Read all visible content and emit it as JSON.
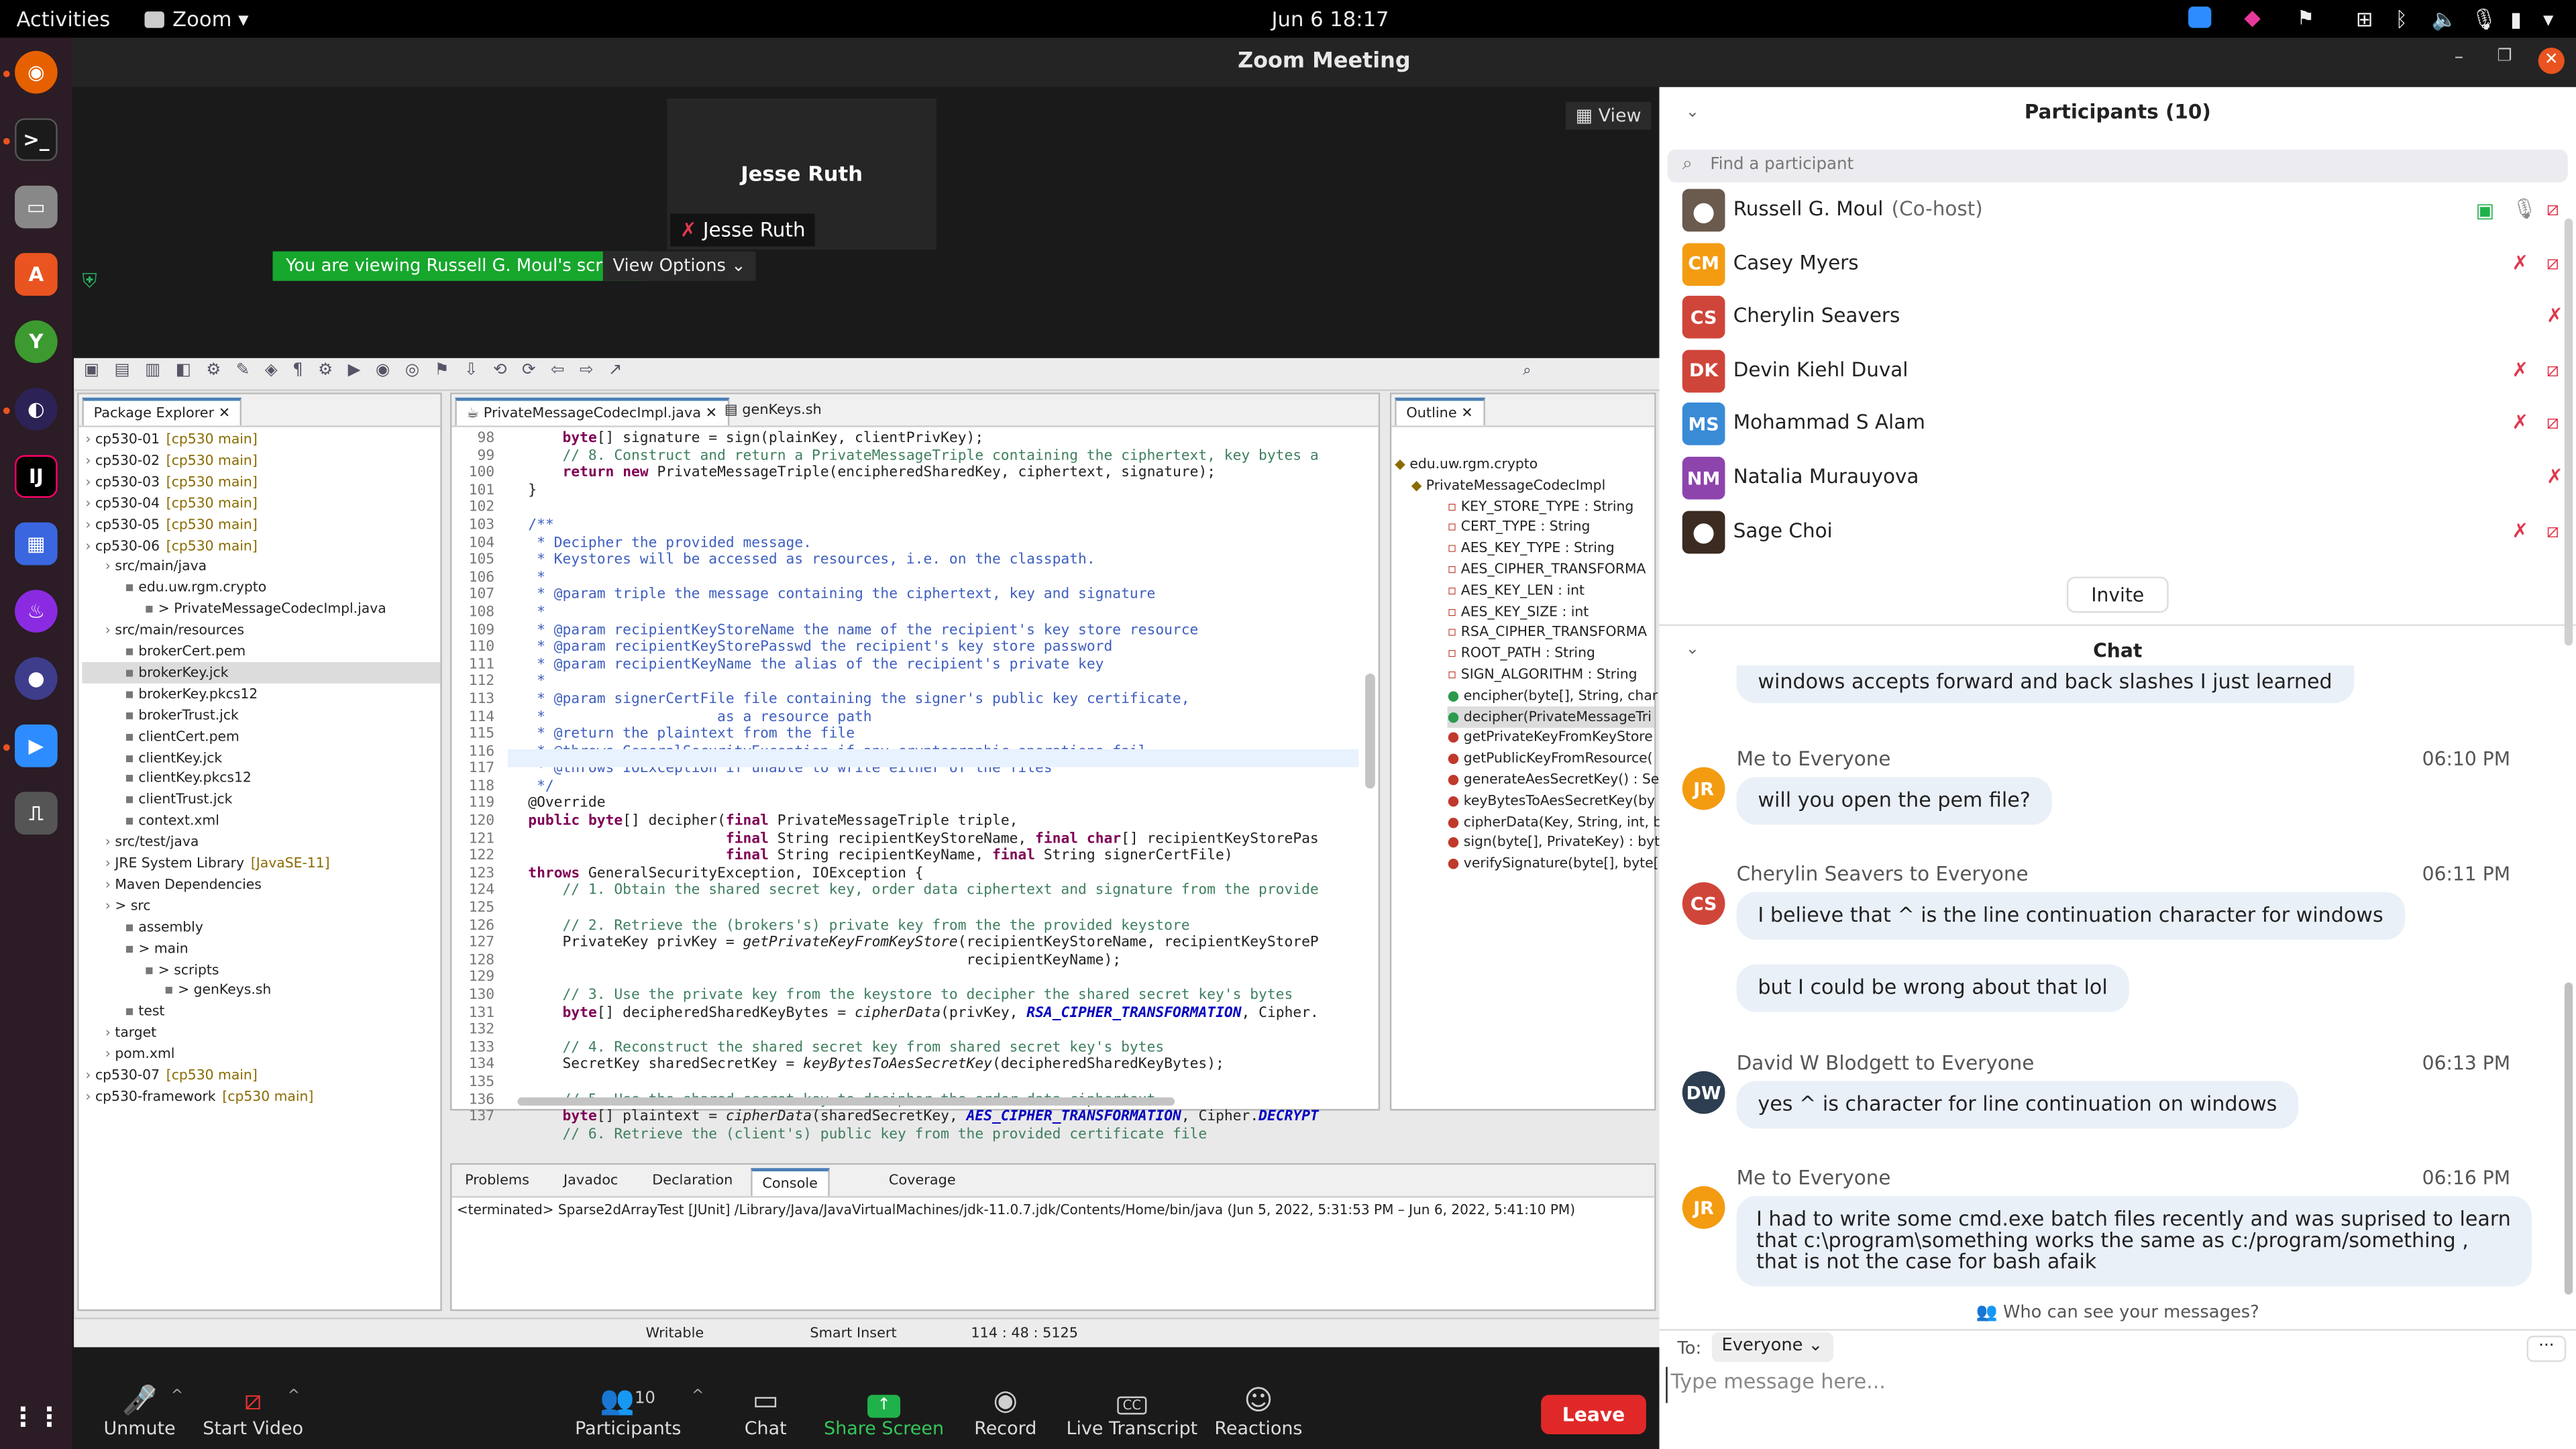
{
  "system": {
    "activities": "Activities",
    "app": "Zoom",
    "datetime": "Jun 6  18:17"
  },
  "zoom": {
    "title": "Zoom Meeting",
    "view_label": "View",
    "video_tile_name": "Jesse Ruth",
    "video_tile_caption": "Jesse Ruth",
    "viewing_banner": "You are viewing Russell G. Moul's screen",
    "view_options": "View Options"
  },
  "eclipse": {
    "package_explorer_title": "Package Explorer",
    "editor_tabs": [
      "PrivateMessageCodecImpl.java",
      "genKeys.sh"
    ],
    "outline_title": "Outline",
    "tree": [
      {
        "label": "cp530-01",
        "meta": "[cp530 main]",
        "indent": 0
      },
      {
        "label": "cp530-02",
        "meta": "[cp530 main]",
        "indent": 0
      },
      {
        "label": "cp530-03",
        "meta": "[cp530 main]",
        "indent": 0
      },
      {
        "label": "cp530-04",
        "meta": "[cp530 main]",
        "indent": 0
      },
      {
        "label": "cp530-05",
        "meta": "[cp530 main]",
        "indent": 0
      },
      {
        "label": "cp530-06",
        "meta": "[cp530 main]",
        "indent": 0
      },
      {
        "label": "src/main/java",
        "meta": "",
        "indent": 1
      },
      {
        "label": "edu.uw.rgm.crypto",
        "meta": "",
        "indent": 2
      },
      {
        "label": "> PrivateMessageCodecImpl.java",
        "meta": "",
        "indent": 3
      },
      {
        "label": "src/main/resources",
        "meta": "",
        "indent": 1
      },
      {
        "label": "brokerCert.pem",
        "meta": "",
        "indent": 2
      },
      {
        "label": "brokerKey.jck",
        "meta": "",
        "indent": 2
      },
      {
        "label": "brokerKey.pkcs12",
        "meta": "",
        "indent": 2
      },
      {
        "label": "brokerTrust.jck",
        "meta": "",
        "indent": 2
      },
      {
        "label": "clientCert.pem",
        "meta": "",
        "indent": 2
      },
      {
        "label": "clientKey.jck",
        "meta": "",
        "indent": 2
      },
      {
        "label": "clientKey.pkcs12",
        "meta": "",
        "indent": 2
      },
      {
        "label": "clientTrust.jck",
        "meta": "",
        "indent": 2
      },
      {
        "label": "context.xml",
        "meta": "",
        "indent": 2
      },
      {
        "label": "src/test/java",
        "meta": "",
        "indent": 1
      },
      {
        "label": "JRE System Library",
        "meta": "[JavaSE-11]",
        "indent": 1
      },
      {
        "label": "Maven Dependencies",
        "meta": "",
        "indent": 1
      },
      {
        "label": "> src",
        "meta": "",
        "indent": 1
      },
      {
        "label": "assembly",
        "meta": "",
        "indent": 2
      },
      {
        "label": "> main",
        "meta": "",
        "indent": 2
      },
      {
        "label": "> scripts",
        "meta": "",
        "indent": 3
      },
      {
        "label": "> genKeys.sh",
        "meta": "",
        "indent": 4
      },
      {
        "label": "test",
        "meta": "",
        "indent": 2
      },
      {
        "label": "target",
        "meta": "",
        "indent": 1
      },
      {
        "label": "pom.xml",
        "meta": "",
        "indent": 1
      },
      {
        "label": "cp530-07",
        "meta": "[cp530 main]",
        "indent": 0
      },
      {
        "label": "cp530-framework",
        "meta": "[cp530 main]",
        "indent": 0
      }
    ],
    "line_numbers": [
      "98",
      "99",
      "100",
      "101",
      "102",
      "103",
      "104",
      "105",
      "106",
      "107",
      "108",
      "109",
      "110",
      "111",
      "112",
      "113",
      "114",
      "115",
      "116",
      "117",
      "118",
      "119",
      "120",
      "121",
      "122",
      "123",
      "124",
      "125",
      "126",
      "127",
      "128",
      "129",
      "130",
      "131",
      "132",
      "133",
      "134",
      "135",
      "136",
      "137"
    ],
    "code_lines": [
      "      byte[] signature = sign(plainKey, clientPrivKey);",
      "      // 8. Construct and return a PrivateMessageTriple containing the ciphertext, key bytes a",
      "      return new PrivateMessageTriple(encipheredSharedKey, ciphertext, signature);",
      "  }",
      "",
      "  /**",
      "   * Decipher the provided message.",
      "   * Keystores will be accessed as resources, i.e. on the classpath.",
      "   *",
      "   * @param triple the message containing the ciphertext, key and signature",
      "   *",
      "   * @param recipientKeyStoreName the name of the recipient's key store resource",
      "   * @param recipientKeyStorePasswd the recipient's key store password",
      "   * @param recipientKeyName the alias of the recipient's private key",
      "   *",
      "   * @param signerCertFile file containing the signer's public key certificate,",
      "   *                    as a resource path",
      "   * @return the plaintext from the file",
      "   * @throws GeneralSecurityException if any cryptographic operations fail",
      "   * @throws IOException if unable to write either of the files",
      "   */",
      "  @Override",
      "  public byte[] decipher(final PrivateMessageTriple triple,",
      "                         final String recipientKeyStoreName, final char[] recipientKeyStorePas",
      "                         final String recipientKeyName, final String signerCertFile)",
      "  throws GeneralSecurityException, IOException {",
      "      // 1. Obtain the shared secret key, order data ciphertext and signature from the provide",
      "",
      "      // 2. Retrieve the (brokers's) private key from the the provided keystore",
      "      PrivateKey privKey = getPrivateKeyFromKeyStore(recipientKeyStoreName, recipientKeyStoreP",
      "                                                     recipientKeyName);",
      "",
      "      // 3. Use the private key from the keystore to decipher the shared secret key's bytes",
      "      byte[] decipheredSharedKeyBytes = cipherData(privKey, RSA_CIPHER_TRANSFORMATION, Cipher.",
      "",
      "      // 4. Reconstruct the shared secret key from shared secret key's bytes",
      "      SecretKey sharedSecretKey = keyBytesToAesSecretKey(decipheredSharedKeyBytes);",
      "",
      "      // 5. Use the shared secret key to decipher the order data ciphertext",
      "      byte[] plaintext = cipherData(sharedSecretKey, AES_CIPHER_TRANSFORMATION, Cipher.DECRYPT",
      "      // 6. Retrieve the (client's) public key from the provided certificate file"
    ],
    "outline": [
      "edu.uw.rgm.crypto",
      "PrivateMessageCodecImpl",
      "KEY_STORE_TYPE : String",
      "CERT_TYPE : String",
      "AES_KEY_TYPE : String",
      "AES_CIPHER_TRANSFORMA",
      "AES_KEY_LEN : int",
      "AES_KEY_SIZE : int",
      "RSA_CIPHER_TRANSFORMA",
      "ROOT_PATH : String",
      "SIGN_ALGORITHM : String",
      "encipher(byte[], String, char",
      "decipher(PrivateMessageTri",
      "getPrivateKeyFromKeyStore",
      "getPublicKeyFromResource(",
      "generateAesSecretKey() : Se",
      "keyBytesToAesSecretKey(by",
      "cipherData(Key, String, int, b",
      "sign(byte[], PrivateKey) : byt",
      "verifySignature(byte[], byte["
    ],
    "bottom_tabs": [
      "Problems",
      "Javadoc",
      "Declaration",
      "Console",
      "Coverage"
    ],
    "console_line": "<terminated> Sparse2dArrayTest [JUnit] /Library/Java/JavaVirtualMachines/jdk-11.0.7.jdk/Contents/Home/bin/java  (Jun 5, 2022, 5:31:53 PM – Jun 6, 2022, 5:41:10 PM)",
    "status": {
      "writable": "Writable",
      "insert": "Smart Insert",
      "position": "114 : 48 : 5125"
    }
  },
  "participants": {
    "title": "Participants (10)",
    "search_placeholder": "Find a participant",
    "list": [
      {
        "initials": "",
        "name": "Russell G. Moul",
        "role": "(Co-host)",
        "color": "#6b5a4e"
      },
      {
        "initials": "CM",
        "name": "Casey Myers",
        "role": "",
        "color": "#f39c12"
      },
      {
        "initials": "CS",
        "name": "Cherylin Seavers",
        "role": "",
        "color": "#d0453a"
      },
      {
        "initials": "DK",
        "name": "Devin Kiehl Duval",
        "role": "",
        "color": "#d0453a"
      },
      {
        "initials": "MS",
        "name": "Mohammad S Alam",
        "role": "",
        "color": "#3a8bd6"
      },
      {
        "initials": "NM",
        "name": "Natalia Murauyova",
        "role": "",
        "color": "#8e44ad"
      },
      {
        "initials": "",
        "name": "Sage Choi",
        "role": "",
        "color": "#3b2b20"
      }
    ],
    "invite": "Invite"
  },
  "chat": {
    "title": "Chat",
    "partial_message": "windows accepts forward and back slashes I just learned",
    "messages": [
      {
        "initials": "JR",
        "color": "#f39c12",
        "sender": "Me to Everyone",
        "time": "06:10 PM",
        "texts": [
          "will you open the pem file?"
        ]
      },
      {
        "initials": "CS",
        "color": "#d0453a",
        "sender": "Cherylin Seavers to Everyone",
        "time": "06:11 PM",
        "texts": [
          "I believe that ^ is the line continuation character for windows",
          "but I could be wrong about that lol"
        ]
      },
      {
        "initials": "DW",
        "color": "#2c3e50",
        "sender": "David W Blodgett to Everyone",
        "time": "06:13 PM",
        "texts": [
          "yes ^ is character for line continuation on windows"
        ]
      },
      {
        "initials": "JR",
        "color": "#f39c12",
        "sender": "Me to Everyone",
        "time": "06:16 PM",
        "texts": [
          "I had to write some cmd.exe batch files recently and was suprised to learn that c:\\program\\something works the same as c:/program/something , that is not the case for bash afaik"
        ]
      }
    ],
    "who_can_see": "Who can see your messages?",
    "to_label": "To:",
    "to_value": "Everyone",
    "input_placeholder": "Type message here..."
  },
  "toolbar": {
    "unmute": "Unmute",
    "start_video": "Start Video",
    "participants": "Participants",
    "participants_count": "10",
    "chat": "Chat",
    "share_screen": "Share Screen",
    "record": "Record",
    "live_transcript": "Live Transcript",
    "reactions": "Reactions",
    "leave": "Leave"
  },
  "colors": {
    "zoom_green": "#0e9f26",
    "leave_red": "#e02828",
    "accent_blue": "#0e72ed"
  }
}
